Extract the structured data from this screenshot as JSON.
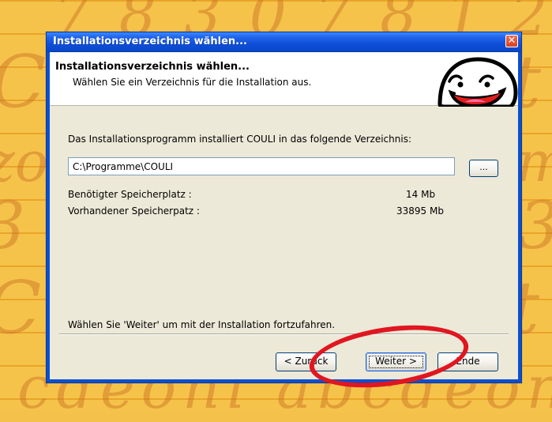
{
  "window": {
    "title": "Installationsverzeichnis wählen..."
  },
  "header": {
    "title": "Installationsverzeichnis wählen...",
    "subtitle": "Wählen Sie ein Verzeichnis für die Installation aus."
  },
  "main": {
    "instruction": "Das Installationsprogramm installiert COULI in das folgende Verzeichnis:",
    "install_path": "C:\\Programme\\COULI",
    "browse_label": "...",
    "required_space_label": "Benötigter Speicherplatz :",
    "required_space_value": "14 Mb",
    "available_space_label": "Vorhandener Speicherpatz :",
    "available_space_value": "33895 Mb",
    "continue_text": "Wählen Sie 'Weiter' um mit der Installation fortzufahren."
  },
  "buttons": {
    "back": "< Zurück",
    "next": "Weiter >",
    "end": "Ende"
  },
  "icons": {
    "close": "close-icon",
    "mascot": "mascot-icon"
  },
  "colors": {
    "titlebar": "#0b4fd1",
    "window_face": "#ece9d8",
    "annotation": "#e01620",
    "background": "#f4c24a"
  }
}
